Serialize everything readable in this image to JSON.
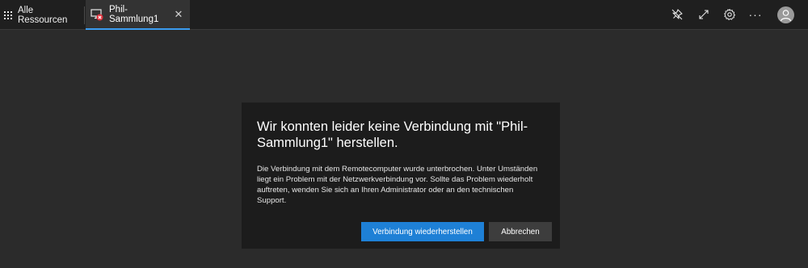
{
  "topbar": {
    "all_resources_label": "Alle Ressourcen",
    "tab": {
      "label": "Phil-Sammlung1",
      "close_glyph": "✕"
    },
    "actions": [
      {
        "icon": "pin-off-icon"
      },
      {
        "icon": "fullscreen-icon"
      },
      {
        "icon": "gear-icon"
      },
      {
        "icon": "more-icon",
        "glyph": "···"
      },
      {
        "icon": "user-avatar-icon"
      }
    ]
  },
  "dialog": {
    "title": "Wir konnten leider keine Verbindung mit \"Phil-Sammlung1\" herstellen.",
    "body": "Die Verbindung mit dem Remotecomputer wurde unterbrochen. Unter Umständen liegt ein Problem mit der Netzwerkverbindung vor. Sollte das Problem wiederholt auftreten, wenden Sie sich an Ihren Administrator oder an den technischen Support.",
    "primary_button": "Verbindung wiederherstellen",
    "secondary_button": "Abbrechen"
  },
  "colors": {
    "background": "#2b2b2b",
    "topbar": "#1f1f1f",
    "dialog": "#1c1c1c",
    "accent": "#1e80d6",
    "tab_underline": "#3b9cf0",
    "error": "#e0303b"
  }
}
